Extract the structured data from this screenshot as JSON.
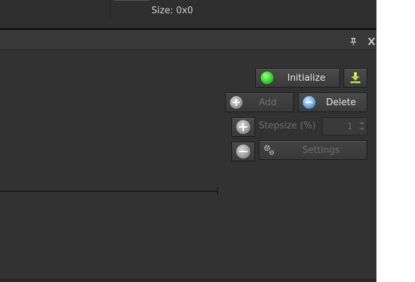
{
  "top": {
    "size_label": "Size: 0x0"
  },
  "panel": {
    "pin_icon": "pin-icon",
    "close_icon": "close-icon"
  },
  "toolbar": {
    "initialize_label": "Initialize",
    "add_label": "Add",
    "delete_label": "Delete",
    "stepsize_label": "Stepsize (%)",
    "stepsize_value": "1",
    "settings_label": "Settings"
  },
  "colors": {
    "background": "#323232",
    "status_green": "#2fd42a",
    "delete_blue": "#6aa8e8",
    "download_green": "#c6e84a"
  }
}
